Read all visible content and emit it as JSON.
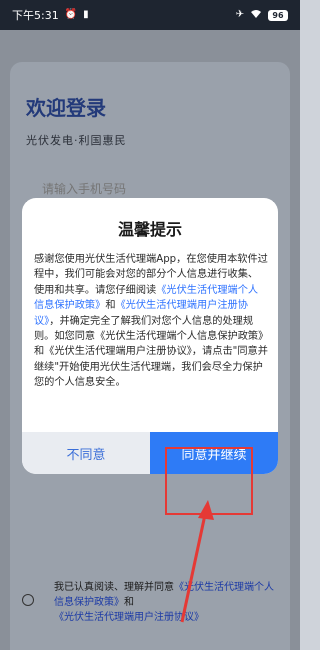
{
  "status_bar": {
    "time": "下午5:31",
    "battery": "96",
    "icons": [
      "alarm-icon",
      "sim-icon",
      "airplane-icon",
      "wifi-icon",
      "battery-icon"
    ]
  },
  "background": {
    "title": "欢迎登录",
    "subtitle": "光伏发电·利国惠民",
    "phone_placeholder": "请输入手机号码",
    "agreement_prefix": "我已认真阅读、理解并同意",
    "agreement_link1": "《光伏生活代理端个人信息保护政策》",
    "agreement_and": "和",
    "agreement_link2": "《光伏生活代理端用户注册协议》"
  },
  "dialog": {
    "title": "温馨提示",
    "p1": "感谢您使用光伏生活代理端App，在您使用本软件过程中，我们可能会对您的部分个人信息进行收集、使用和共享。请您仔细阅读",
    "link1": "《光伏生活代理端个人信息保护政策》",
    "and1": "和",
    "link2": "《光伏生活代理端用户注册协议》",
    "p2": "，并确定完全了解我们对您个人信息的处理规则。如您同意《光伏生活代理端个人信息保护政策》和《光伏生活代理端用户注册协议》，请点击\"同意并继续\"开始使用光伏生活代理端，我们会尽全力保护您的个人信息安全。",
    "disagree_label": "不同意",
    "agree_label": "同意并继续"
  },
  "colors": {
    "accent": "#2e7bf6",
    "link": "#2f73ff",
    "annotation": "#e53935"
  }
}
